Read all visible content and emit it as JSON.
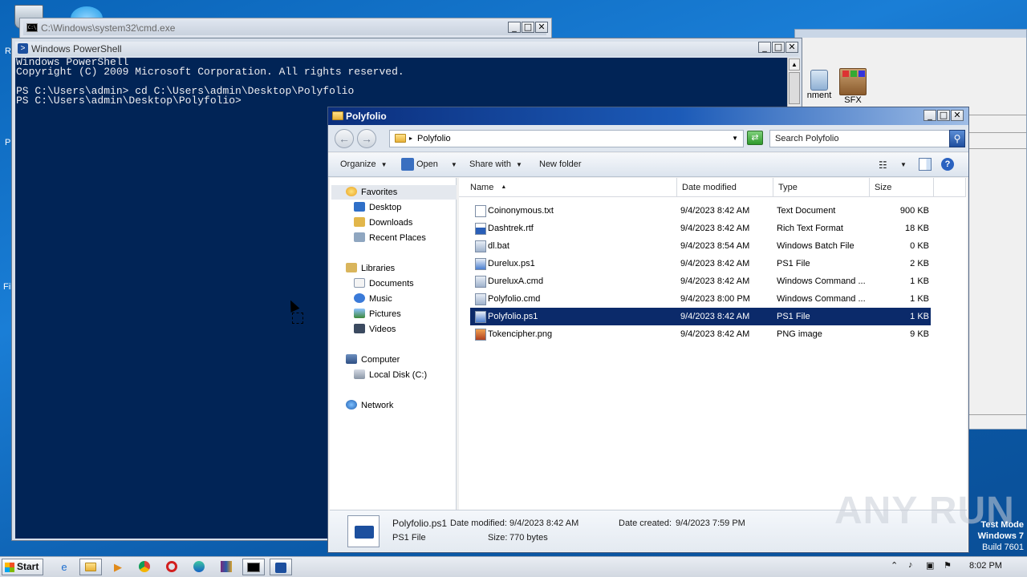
{
  "desktop": {
    "edge_letters": [
      "R",
      "P",
      "Fil"
    ],
    "watermark": "ANY RUN",
    "test_mode": {
      "line1": "Test Mode",
      "line2": "Windows 7",
      "line3": "Build 7601"
    }
  },
  "bg_app": {
    "tools": [
      {
        "label": "nment",
        "icon": "comment-icon"
      },
      {
        "label": "SFX",
        "icon": "sfx-icon"
      }
    ]
  },
  "cmd_window": {
    "title": "C:\\Windows\\system32\\cmd.exe",
    "controls": {
      "minimize": "_",
      "maximize": "□",
      "close": "✕"
    }
  },
  "powershell": {
    "title": "Windows PowerShell",
    "lines": [
      "Windows PowerShell",
      "Copyright (C) 2009 Microsoft Corporation. All rights reserved.",
      "",
      "PS C:\\Users\\admin> cd C:\\Users\\admin\\Desktop\\Polyfolio",
      "PS C:\\Users\\admin\\Desktop\\Polyfolio>"
    ],
    "controls": {
      "minimize": "_",
      "maximize": "□",
      "close": "✕"
    }
  },
  "explorer": {
    "title": "Polyfolio",
    "address": "Polyfolio",
    "search_placeholder": "Search Polyfolio",
    "toolbar": {
      "organize": "Organize",
      "open": "Open",
      "share_with": "Share with",
      "new_folder": "New folder"
    },
    "nav": {
      "favorites": "Favorites",
      "favorites_items": [
        "Desktop",
        "Downloads",
        "Recent Places"
      ],
      "libraries": "Libraries",
      "libraries_items": [
        "Documents",
        "Music",
        "Pictures",
        "Videos"
      ],
      "computer": "Computer",
      "computer_items": [
        "Local Disk (C:)"
      ],
      "network": "Network"
    },
    "columns": {
      "name": "Name",
      "date": "Date modified",
      "type": "Type",
      "size": "Size"
    },
    "files": [
      {
        "name": "Coinonymous.txt",
        "date": "9/4/2023 8:42 AM",
        "type": "Text Document",
        "size": "900 KB",
        "icon": "text-file-icon"
      },
      {
        "name": "Dashtrek.rtf",
        "date": "9/4/2023 8:42 AM",
        "type": "Rich Text Format",
        "size": "18 KB",
        "icon": "rtf-file-icon"
      },
      {
        "name": "dl.bat",
        "date": "9/4/2023 8:54 AM",
        "type": "Windows Batch File",
        "size": "0 KB",
        "icon": "batch-file-icon"
      },
      {
        "name": "Durelux.ps1",
        "date": "9/4/2023 8:42 AM",
        "type": "PS1 File",
        "size": "2 KB",
        "icon": "ps1-file-icon"
      },
      {
        "name": "DureluxA.cmd",
        "date": "9/4/2023 8:42 AM",
        "type": "Windows Command ...",
        "size": "1 KB",
        "icon": "cmd-file-icon"
      },
      {
        "name": "Polyfolio.cmd",
        "date": "9/4/2023 8:00 PM",
        "type": "Windows Command ...",
        "size": "1 KB",
        "icon": "cmd-file-icon"
      },
      {
        "name": "Polyfolio.ps1",
        "date": "9/4/2023 8:42 AM",
        "type": "PS1 File",
        "size": "1 KB",
        "icon": "ps1-file-icon",
        "selected": true
      },
      {
        "name": "Tokencipher.png",
        "date": "9/4/2023 8:42 AM",
        "type": "PNG image",
        "size": "9 KB",
        "icon": "png-file-icon"
      }
    ],
    "details": {
      "name": "Polyfolio.ps1",
      "type": "PS1 File",
      "date_modified_label": "Date modified:",
      "date_modified": "9/4/2023 8:42 AM",
      "date_created_label": "Date created:",
      "date_created": "9/4/2023 7:59 PM",
      "size_label": "Size:",
      "size": "770 bytes"
    }
  },
  "taskbar": {
    "start_label": "Start",
    "clock": "8:02 PM"
  }
}
